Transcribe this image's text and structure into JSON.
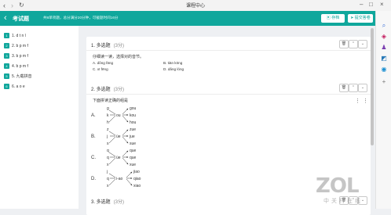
{
  "browser": {
    "tab_title": "课程中心",
    "back_icon": "‹",
    "forward_icon": "›",
    "refresh_icon": "↻"
  },
  "header": {
    "back_icon": "‹",
    "title": "考试题",
    "info": "共8单项题，总分满分20分钟，可截题时间16分",
    "save_label": "存档",
    "submit_label": "提交答卷"
  },
  "sidebar": {
    "items": [
      {
        "num": "1",
        "label": "1. d t n l"
      },
      {
        "num": "2",
        "label": "2. b p m f"
      },
      {
        "num": "3",
        "label": "3. b p m f"
      },
      {
        "num": "4",
        "label": "4. b p m f"
      },
      {
        "num": "5",
        "label": "5. 九载拼音"
      },
      {
        "num": "6",
        "label": "6. a o e"
      }
    ]
  },
  "questions": [
    {
      "header": "1. 多选题",
      "score": "(3分)",
      "stem": "仔细读一读，选择对的音节。",
      "options": [
        "A. dǒng fāng",
        "B. tiān kōng",
        "C. xī fēng",
        "D. dǎng lóng"
      ]
    },
    {
      "header": "2. 多选题",
      "score": "(3分)",
      "stem": "下面拼读正确的组是",
      "options": [
        "A.",
        "B.",
        "C.",
        "D."
      ],
      "diagrams": [
        {
          "initials": [
            "g",
            "k",
            "h"
          ],
          "final": "ou",
          "results": [
            "gou",
            "kou",
            "hou"
          ]
        },
        {
          "initials": [
            "z",
            "j",
            "s"
          ],
          "final": "üe",
          "results": [
            "zue",
            "jue",
            "sue"
          ]
        },
        {
          "initials": [
            "q",
            "q",
            "x"
          ],
          "final": "üe",
          "results": [
            "que",
            "que",
            "xue"
          ]
        },
        {
          "initials": [
            "j",
            "q",
            "x"
          ],
          "final": "i-ao",
          "results": [
            "jiao",
            "qiao",
            "xiao"
          ]
        }
      ]
    },
    {
      "header": "3. 多选题",
      "score": "(3分)"
    }
  ],
  "watermark": {
    "logo": "ZOL",
    "text": "中关村在线"
  }
}
